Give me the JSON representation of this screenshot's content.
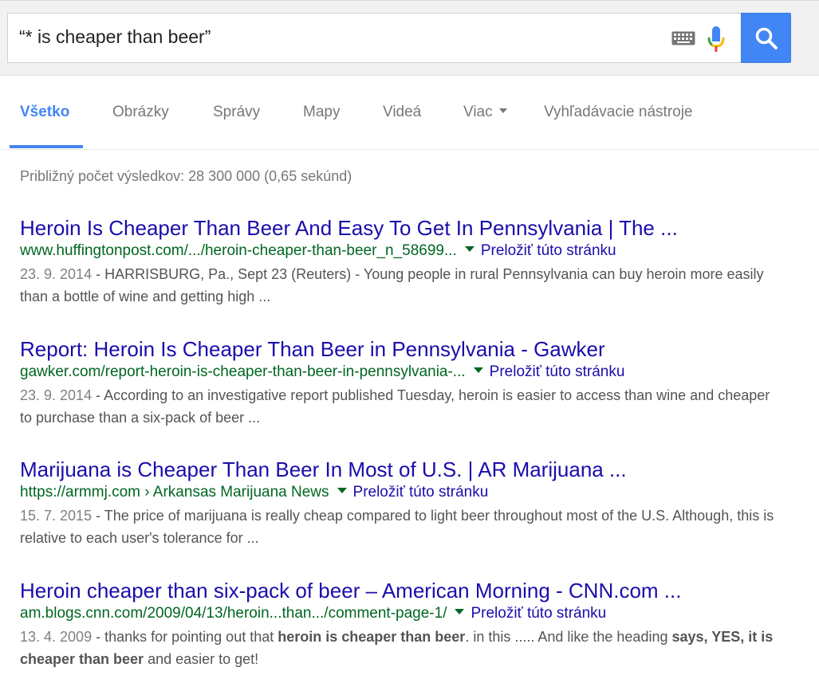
{
  "search": {
    "query": "“* is cheaper than beer”"
  },
  "icons": {
    "keyboard": "keyboard-icon",
    "microphone": "microphone-icon",
    "search": "search-icon",
    "dropdown": "caret-down-icon"
  },
  "colors": {
    "accent": "#4285f4",
    "link": "#1a0dab",
    "url": "#006621",
    "snippet": "#545454"
  },
  "tabs": [
    {
      "label": "Všetko",
      "active": true
    },
    {
      "label": "Obrázky"
    },
    {
      "label": "Správy"
    },
    {
      "label": "Mapy"
    },
    {
      "label": "Videá"
    },
    {
      "label": "Viac"
    },
    {
      "label": "Vyhľadávacie nástroje"
    }
  ],
  "stats": "Približný počet výsledkov: 28 300 000 (0,65 sekúnd)",
  "results": [
    {
      "title": "Heroin Is Cheaper Than Beer And Easy To Get In Pennsylvania | The ...",
      "url": "www.huffingtonpost.com/.../heroin-cheaper-than-beer_n_58699...",
      "translate": "Preložiť túto stránku",
      "date": "23. 9. 2014",
      "snippet": " - HARRISBURG, Pa., Sept 23 (Reuters) - Young people in rural Pennsylvania can buy heroin more easily than a bottle of wine and getting high ..."
    },
    {
      "title": "Report: Heroin Is Cheaper Than Beer in Pennsylvania - Gawker",
      "url": "gawker.com/report-heroin-is-cheaper-than-beer-in-pennsylvania-...",
      "translate": "Preložiť túto stránku",
      "date": "23. 9. 2014",
      "snippet": " - According to an investigative report published Tuesday, heroin is easier to access than wine and cheaper to purchase than a six-pack of beer ..."
    },
    {
      "title": "Marijuana is Cheaper Than Beer In Most of U.S. | AR Marijuana ...",
      "url": "https://armmj.com › Arkansas Marijuana News",
      "translate": "Preložiť túto stránku",
      "date": "15. 7. 2015",
      "snippet": " - The price of marijuana is really cheap compared to light beer throughout most of the U.S. Although, this is relative to each user's tolerance for ..."
    },
    {
      "title": "Heroin cheaper than six-pack of beer – American Morning - CNN.com ...",
      "url": "am.blogs.cnn.com/2009/04/13/heroin...than.../comment-page-1/",
      "translate": "Preložiť túto stránku",
      "date": "13. 4. 2009",
      "snippet_parts": [
        {
          "text": " - thanks for pointing out that ",
          "bold": false
        },
        {
          "text": "heroin is cheaper than beer",
          "bold": true
        },
        {
          "text": ". in this ..... And like the heading ",
          "bold": false
        },
        {
          "text": "says, YES, it is cheaper than beer",
          "bold": true
        },
        {
          "text": " and easier to get!",
          "bold": false
        }
      ]
    }
  ]
}
